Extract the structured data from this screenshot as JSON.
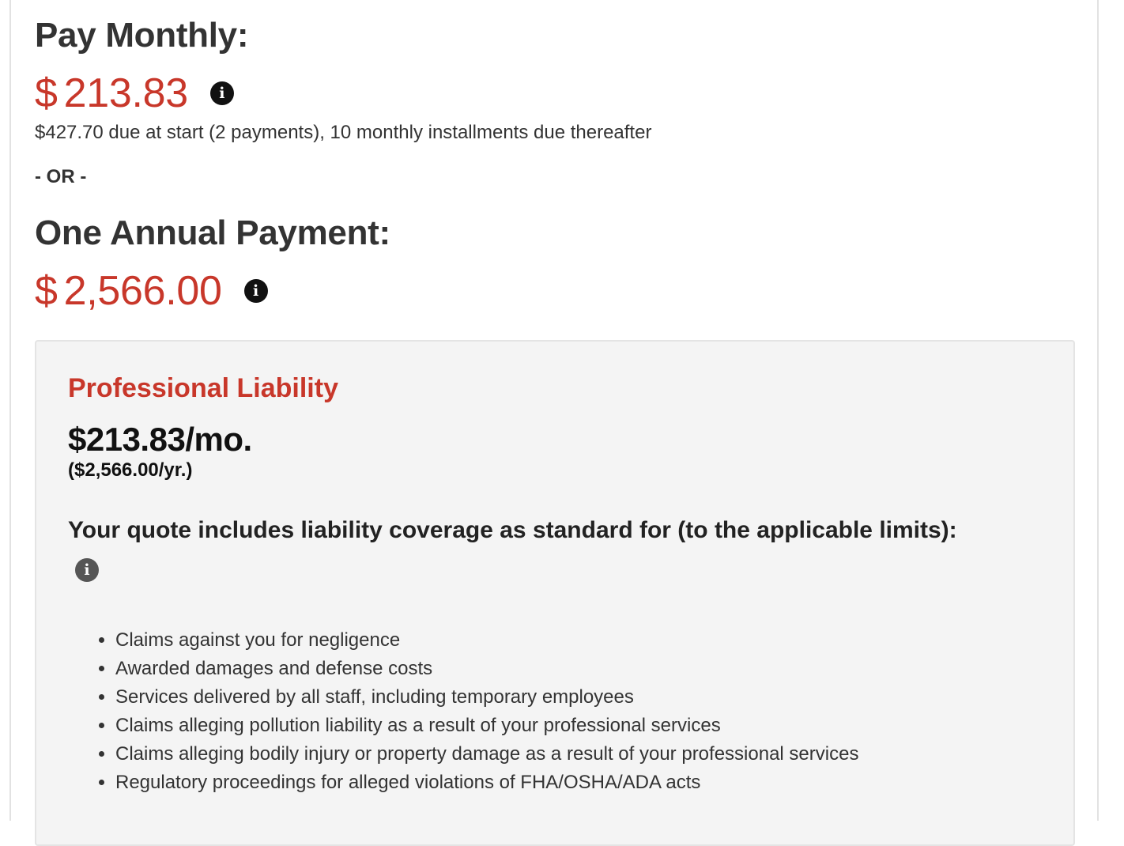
{
  "monthly": {
    "heading": "Pay Monthly:",
    "currency_symbol": "$",
    "amount": "213.83",
    "info_icon": "info-circle-icon",
    "due_text": "$427.70 due at start (2 payments), 10 monthly installments due thereafter"
  },
  "separator": "- OR -",
  "annual": {
    "heading": "One Annual Payment:",
    "currency_symbol": "$",
    "amount": "2,566.00",
    "info_icon": "info-circle-icon"
  },
  "coverage_panel": {
    "title": "Professional Liability",
    "monthly_price": "$213.83/mo.",
    "yearly_price": "($2,566.00/yr.)",
    "heading": "Your quote includes liability coverage as standard for (to the applicable limits):",
    "info_icon": "info-circle-icon",
    "items": [
      "Claims against you for negligence",
      "Awarded damages and defense costs",
      "Services delivered by all staff, including temporary employees",
      "Claims alleging pollution liability as a result of your professional services",
      "Claims alleging bodily injury or property damage as a result of your professional services",
      "Regulatory proceedings for alleged violations of FHA/OSHA/ADA acts"
    ]
  },
  "colors": {
    "price_red": "#c8372a",
    "heading_text": "#333333",
    "panel_background": "#f4f4f4"
  }
}
